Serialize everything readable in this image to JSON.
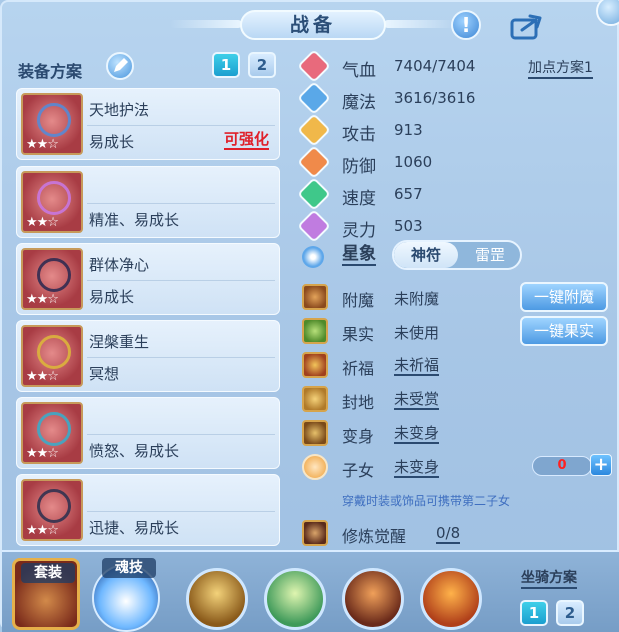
{
  "window": {
    "title": "战备"
  },
  "left": {
    "section_title": "装备方案",
    "plans": [
      "1",
      "2"
    ],
    "cards": [
      {
        "name": "天地护法",
        "attr": "易成长",
        "upgrade": "可强化",
        "stars": "★★☆"
      },
      {
        "name": "",
        "attr": "精准、易成长",
        "upgrade": "",
        "stars": "★★☆"
      },
      {
        "name": "群体净心",
        "attr": "易成长",
        "upgrade": "",
        "stars": "★★☆"
      },
      {
        "name": "涅槃重生",
        "attr": "冥想",
        "upgrade": "",
        "stars": "★★☆"
      },
      {
        "name": "",
        "attr": "愤怒、易成长",
        "upgrade": "",
        "stars": "★★☆"
      },
      {
        "name": "",
        "attr": "迅捷、易成长",
        "upgrade": "",
        "stars": "★★☆"
      }
    ]
  },
  "stats": {
    "plan_link": "加点方案1",
    "rows": [
      {
        "label": "气血",
        "value": "7404/7404",
        "color": "#e86a7c"
      },
      {
        "label": "魔法",
        "value": "3616/3616",
        "color": "#5aa8e8"
      },
      {
        "label": "攻击",
        "value": "913",
        "color": "#f0b84a"
      },
      {
        "label": "防御",
        "value": "1060",
        "color": "#f08a4a"
      },
      {
        "label": "速度",
        "value": "657",
        "color": "#3fc88a"
      },
      {
        "label": "灵力",
        "value": "503",
        "color": "#c07ce0"
      }
    ],
    "star_label": "星象",
    "toggle_on": "神符",
    "toggle_off": "雷罡"
  },
  "functions": {
    "rows": [
      {
        "label": "附魔",
        "value": "未附魔"
      },
      {
        "label": "果实",
        "value": "未使用"
      },
      {
        "label": "祈福",
        "value": "未祈福"
      },
      {
        "label": "封地",
        "value": "未受赏"
      },
      {
        "label": "变身",
        "value": "未变身"
      },
      {
        "label": "子女",
        "value": "未变身"
      }
    ],
    "enchant_button": "一键附魔",
    "fruit_button": "一键果实",
    "child_count": "0",
    "child_plus": "+",
    "hint": "穿戴时装或饰品可携带第二子女",
    "cultivation_label": "修炼觉醒",
    "cultivation_value": "0/8"
  },
  "bottom": {
    "suit_label": "套装",
    "soul_label": "魂技",
    "mount_plan_label": "坐骑方案",
    "mount_plans": [
      "1",
      "2"
    ]
  }
}
